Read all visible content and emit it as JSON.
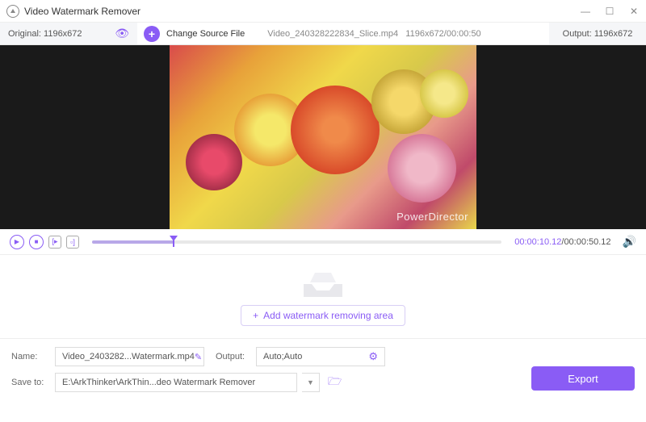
{
  "window": {
    "title": "Video Watermark Remover"
  },
  "toolbar": {
    "original_label": "Original:",
    "original_dim": "1196x672",
    "change_source": "Change Source File",
    "file_name": "Video_240328222834_Slice.mp4",
    "file_meta": "1196x672/00:00:50",
    "output_label": "Output:",
    "output_dim": "1196x672"
  },
  "preview": {
    "watermark_text": "PowerDirector"
  },
  "playback": {
    "current": "00:00:10.12",
    "total": "00:00:50.12",
    "progress_pct": 20
  },
  "drop": {
    "add_button": "Add watermark removing area"
  },
  "fields": {
    "name_label": "Name:",
    "name_value": "Video_2403282...Watermark.mp4",
    "output_label": "Output:",
    "output_value": "Auto;Auto",
    "save_label": "Save to:",
    "save_value": "E:\\ArkThinker\\ArkThin...deo Watermark Remover"
  },
  "actions": {
    "export": "Export"
  }
}
